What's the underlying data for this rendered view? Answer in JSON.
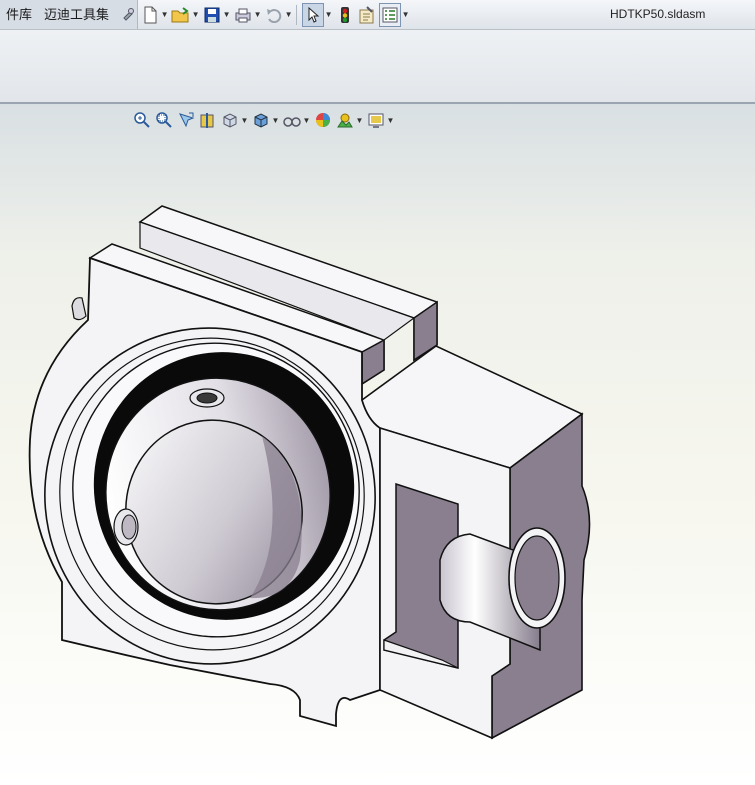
{
  "menu": {
    "items": [
      "件库",
      "迈迪工具集"
    ]
  },
  "document": {
    "title": "HDTKP50.sldasm"
  },
  "toolbar": {
    "tools": [
      {
        "name": "new-icon"
      },
      {
        "name": "open-icon"
      },
      {
        "name": "save-icon"
      },
      {
        "name": "print-icon"
      },
      {
        "name": "undo-icon"
      },
      {
        "name": "select-icon"
      },
      {
        "name": "rebuild-icon"
      },
      {
        "name": "file-properties-icon"
      },
      {
        "name": "options-icon"
      }
    ]
  },
  "heads_up_toolbar": {
    "tools": [
      "zoom-to-fit-icon",
      "zoom-to-area-icon",
      "previous-view-icon",
      "section-view-icon",
      "view-orientation-icon",
      "display-style-icon",
      "hide-show-items-icon",
      "edit-appearance-icon",
      "apply-scene-icon",
      "view-settings-icon"
    ]
  },
  "colors": {
    "body": "#f4f4f6",
    "shadow": "#8a7f8f",
    "seal": "#0a0a0a",
    "accent_red": "#d42020",
    "accent_green": "#1c9a2a"
  }
}
